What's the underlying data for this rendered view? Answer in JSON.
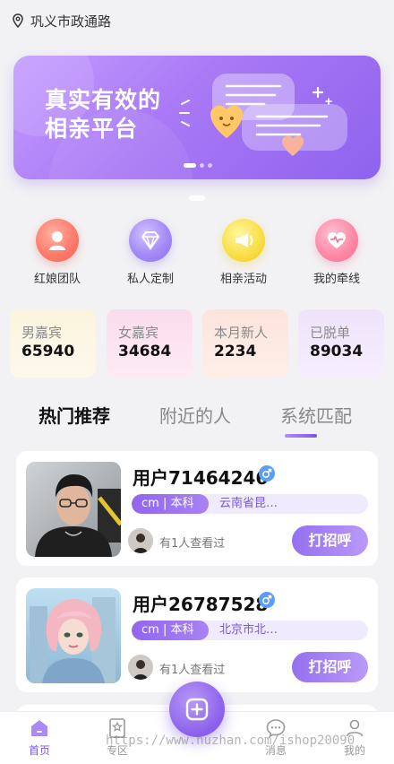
{
  "header": {
    "location": "巩义市政通路"
  },
  "banner": {
    "slogan_line1": "真实有效的",
    "slogan_line2": "相亲平台"
  },
  "quick_nav": [
    {
      "label": "红娘团队",
      "icon": "matchmaker-icon"
    },
    {
      "label": "私人定制",
      "icon": "diamond-icon"
    },
    {
      "label": "相亲活动",
      "icon": "megaphone-icon"
    },
    {
      "label": "我的牵线",
      "icon": "heart-pulse-icon"
    }
  ],
  "stats": [
    {
      "label": "男嘉宾",
      "value": "65940"
    },
    {
      "label": "女嘉宾",
      "value": "34684"
    },
    {
      "label": "本月新人",
      "value": "2234"
    },
    {
      "label": "已脱单",
      "value": "89034"
    }
  ],
  "tabs": [
    {
      "label": "热门推荐",
      "active": true
    },
    {
      "label": "附近的人",
      "active": false
    },
    {
      "label": "系统匹配",
      "active": false
    }
  ],
  "cards": [
    {
      "name": "用户71464246",
      "tag": "cm | 本科",
      "location": "云南省昆…",
      "viewed": "有1人查看过",
      "greet": "打招呼",
      "gender": "male"
    },
    {
      "name": "用户26787528",
      "tag": "cm | 本科",
      "location": "北京市北…",
      "viewed": "有1人查看过",
      "greet": "打招呼",
      "gender": "male"
    }
  ],
  "bottom_nav": [
    {
      "label": "首页",
      "active": true
    },
    {
      "label": "专区",
      "active": false
    },
    {
      "label": "消息",
      "active": false
    },
    {
      "label": "我的",
      "active": false
    }
  ],
  "watermark": "https://www.huzhan.com/ishop20090",
  "colors": {
    "accent": "#7d55e8",
    "male_badge": "#5b9df7"
  }
}
